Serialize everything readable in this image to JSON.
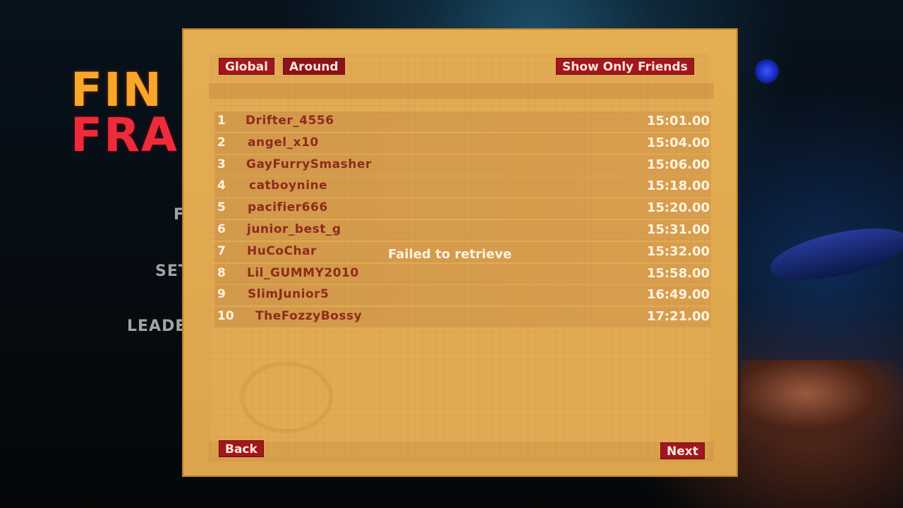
{
  "logo": {
    "line1": "FIN",
    "line2": "FRA"
  },
  "side_menu": [
    "F",
    "SET",
    "LEADE"
  ],
  "tabs": {
    "global": "Global",
    "around": "Around"
  },
  "friends_button": "Show Only Friends",
  "status_text": "Failed to retrieve",
  "leaderboard": [
    {
      "rank": "1",
      "name": "Drifter_4556",
      "time": "15:01.00"
    },
    {
      "rank": "2",
      "name": "angel_x10",
      "time": "15:04.00"
    },
    {
      "rank": "3",
      "name": "GayFurrySmasher",
      "time": "15:06.00"
    },
    {
      "rank": "4",
      "name": "catboynine",
      "time": "15:18.00"
    },
    {
      "rank": "5",
      "name": "pacifier666",
      "time": "15:20.00"
    },
    {
      "rank": "6",
      "name": "junior_best_g",
      "time": "15:31.00"
    },
    {
      "rank": "7",
      "name": "HuCoChar",
      "time": "15:32.00"
    },
    {
      "rank": "8",
      "name": "Lil_GUMMY2010",
      "time": "15:58.00"
    },
    {
      "rank": "9",
      "name": "SlimJunior5",
      "time": "16:49.00"
    },
    {
      "rank": "10",
      "name": "TheFozzyBossy",
      "time": "17:21.00"
    }
  ],
  "nav": {
    "back": "Back",
    "next": "Next"
  },
  "colors": {
    "panel": "#e2aa53",
    "button": "#a2161e",
    "player_name": "#8e2a1c"
  }
}
